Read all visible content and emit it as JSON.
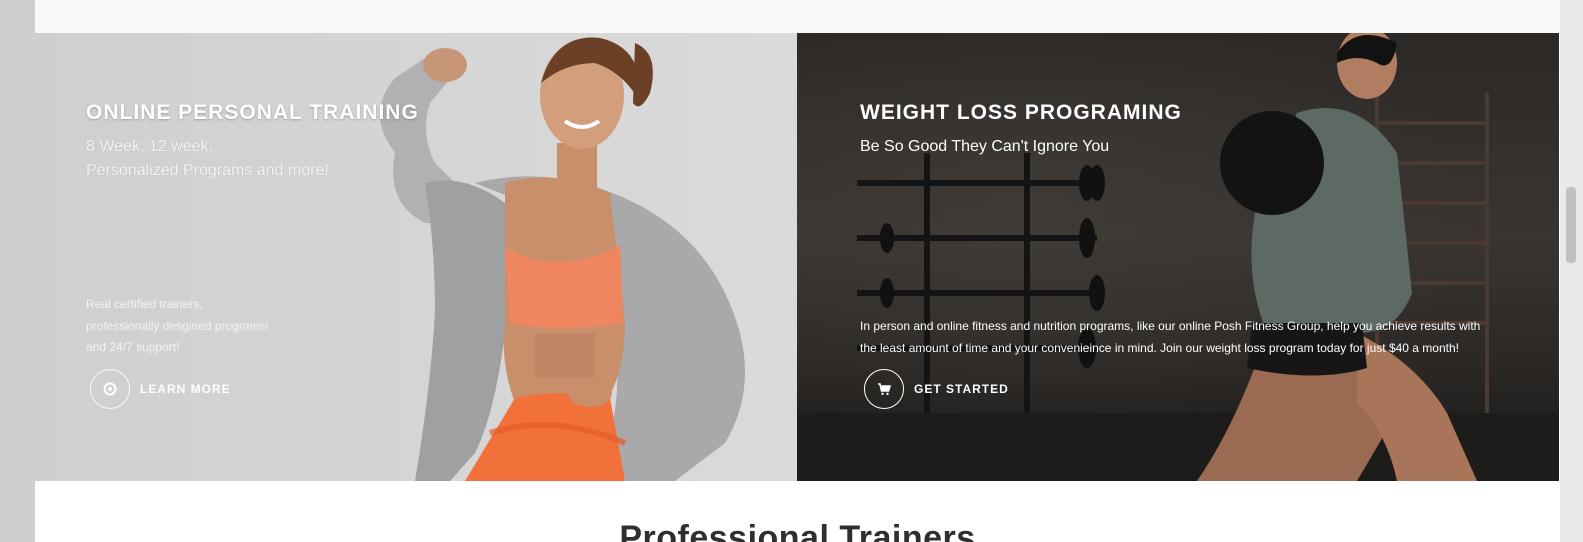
{
  "panels": {
    "left": {
      "title": "ONLINE PERSONAL TRAINING",
      "subtitle_line1": "8 Week, 12 week,",
      "subtitle_line2": "Personalized Programs and more!",
      "body_line1": "Real certified trainers,",
      "body_line2": "professionally desgined programs!",
      "body_line3": "and 24/7 support!",
      "cta_icon": "target-icon",
      "cta_label": "LEARN MORE"
    },
    "right": {
      "title": "WEIGHT LOSS PROGRAMING",
      "subtitle": "Be So Good They Can't Ignore You",
      "body": "In person and online fitness and nutrition programs, like our online Posh Fitness Group, help you achieve results with the least amount of time and your convenieince in mind. Join our weight loss program today for just $40 a month!",
      "cta_icon": "cart-icon",
      "cta_label": "GET STARTED"
    }
  },
  "section": {
    "heading": "Professional Trainers"
  },
  "colors": {
    "page_bg": "#ffffff",
    "outer_bg": "#cfcfcf",
    "left_panel_bg": "#d4d4d4",
    "right_panel_bg": "#2f2b28",
    "heading_text": "#2f2f2f",
    "accent_orange": "#f0865f"
  }
}
